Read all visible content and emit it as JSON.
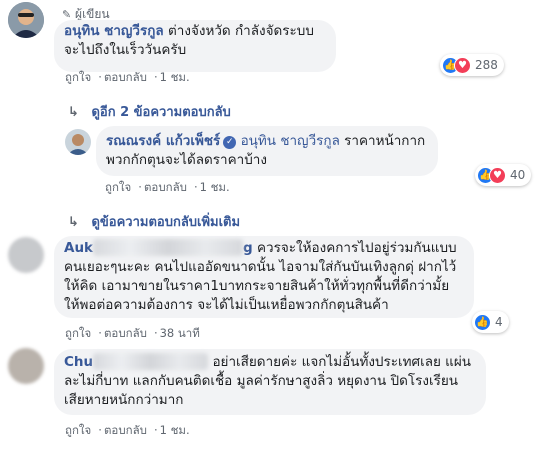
{
  "comment1": {
    "author_badge": "ผู้เขียน",
    "author": "อนุทิน ชาญวีรกูล",
    "text": "ต่างจังหวัด กำลังจัดระบบ จะไปถึงในเร็ววันครับ",
    "like_label": "ถูกใจ",
    "reply_label": "ตอบกลับ",
    "time": "1 ชม.",
    "reaction_count": "288"
  },
  "more_replies_label": "ดูอีก 2 ข้อความตอบกลับ",
  "reply1": {
    "author": "รณณรงค์ แก้วเพ็ชร์",
    "tagged": "อนุทิน ชาญวีรกูล",
    "text": "ราคาหน้ากากพวกกักตุนจะได้ลดราคาบ้าง",
    "like_label": "ถูกใจ",
    "reply_label": "ตอบกลับ",
    "time": "1 ชม.",
    "reaction_count": "40"
  },
  "view_more_replies_label": "ดูข้อความตอบกลับเพิ่มเติม",
  "comment2": {
    "author_visible_start": "Auk",
    "author_visible_end": "g",
    "text": "ควรจะให้องคการไปอยู่ร่วมกันแบบคนเยอะๆนะคะ คนไปแออัดขนาดนั้น ไอจามใส่กันบันเทิงลูกดุ่ ฝากไว้ให้คิด เอามาขายในราคา1บาทกระจายสินค้าให้ทั่วทุกพื้นที่ดีกว่ามั้ย ให้พอต่อความต้องการ จะได้ไม่เป็นเหยื่อพวกกักตุนสินค้า",
    "like_label": "ถูกใจ",
    "reply_label": "ตอบกลับ",
    "time": "38 นาที",
    "reaction_count": "4"
  },
  "comment3": {
    "author_visible_start": "Chu",
    "text": "อย่าเสียดายค่ะ แจกไม่อั้นทั้งประเทศเลย แผ่นละไม่กี่บาท แลกกับคนติดเชื้อ มูลค่ารักษาสูงลิ่ว หยุดงาน ปิดโรงเรียน เสียหายหนักกว่ามาก",
    "like_label": "ถูกใจ",
    "reply_label": "ตอบกลับ",
    "time": "1 ชม."
  },
  "colors": {
    "link": "#385898",
    "bubble": "#f2f3f5",
    "like": "#2078f4",
    "love": "#f33e58"
  }
}
